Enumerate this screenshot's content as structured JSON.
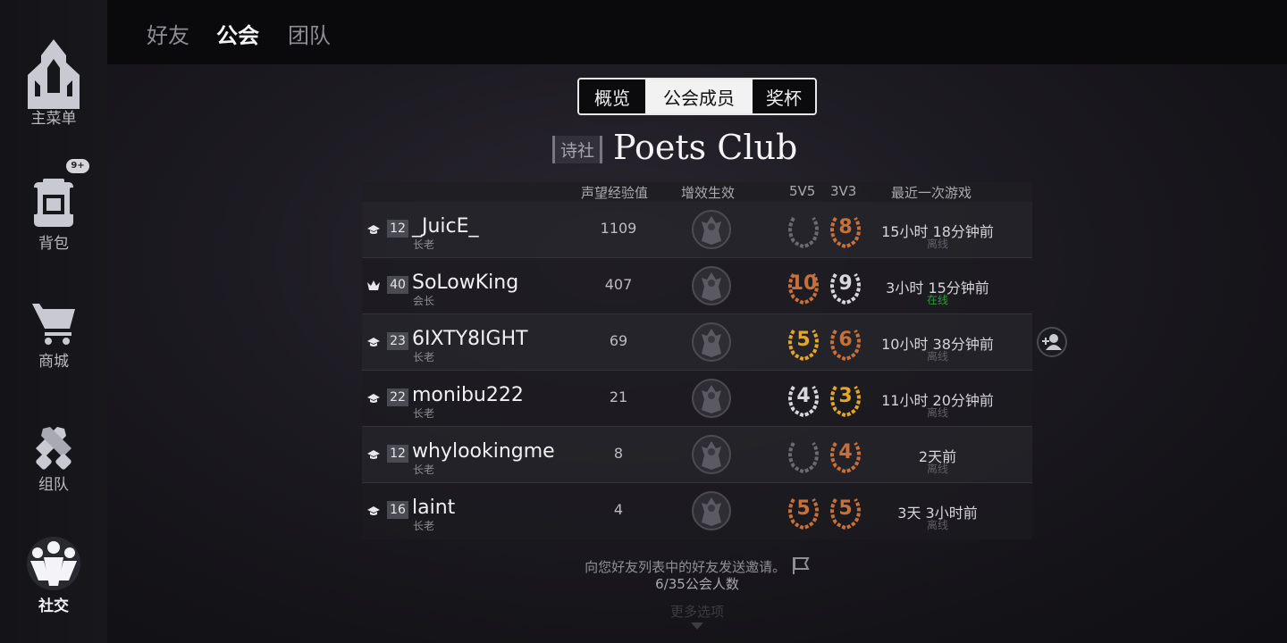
{
  "sidebar": {
    "items": [
      {
        "label": "主菜单",
        "icon": "castle-icon"
      },
      {
        "label": "背包",
        "icon": "backpack-icon",
        "badge": "9+"
      },
      {
        "label": "商城",
        "icon": "cart-icon"
      },
      {
        "label": "组队",
        "icon": "team-icon"
      },
      {
        "label": "社交",
        "icon": "social-icon",
        "active": true
      }
    ]
  },
  "top_tabs": [
    {
      "label": "好友"
    },
    {
      "label": "公会",
      "active": true
    },
    {
      "label": "团队"
    }
  ],
  "segment_tabs": [
    {
      "label": "概览"
    },
    {
      "label": "公会成员",
      "active": true
    },
    {
      "label": "奖杯"
    }
  ],
  "club": {
    "tag": "诗社",
    "name": "Poets Club"
  },
  "table": {
    "headers": {
      "reputation": "声望经验值",
      "boost": "增效生效",
      "mode_5v5": "5V5",
      "mode_3v3": "3V3",
      "last_game": "最近一次游戏"
    },
    "rows": [
      {
        "rank_icon": "elder-hat-icon",
        "level": "12",
        "name": "_JuicE_",
        "role": "长老",
        "reputation": "1109",
        "m5v5": "",
        "m5v5_color": "#6a6a70",
        "m3v3": "8",
        "m3v3_color": "#c8703a",
        "last_game": "15小时 18分钟前",
        "status": "离线"
      },
      {
        "rank_icon": "crown-icon",
        "level": "40",
        "name": "SoLowKing",
        "role": "会长",
        "reputation": "407",
        "m5v5": "10",
        "m5v5_color": "#c8703a",
        "m3v3": "9",
        "m3v3_color": "#d8d8dc",
        "last_game": "3小时 15分钟前",
        "status": "在线"
      },
      {
        "rank_icon": "elder-hat-icon",
        "level": "23",
        "name": "6IXTY8IGHT",
        "role": "长老",
        "reputation": "69",
        "m5v5": "5",
        "m5v5_color": "#e3a62a",
        "m3v3": "6",
        "m3v3_color": "#c8703a",
        "last_game": "10小时 38分钟前",
        "status": "离线"
      },
      {
        "rank_icon": "elder-hat-icon",
        "level": "22",
        "name": "monibu222",
        "role": "长老",
        "reputation": "21",
        "m5v5": "4",
        "m5v5_color": "#d8d8dc",
        "m3v3": "3",
        "m3v3_color": "#e3a62a",
        "last_game": "11小时 20分钟前",
        "status": "离线"
      },
      {
        "rank_icon": "elder-hat-icon",
        "level": "12",
        "name": "whylookingme",
        "role": "长老",
        "reputation": "8",
        "m5v5": "",
        "m5v5_color": "#6a6a70",
        "m3v3": "4",
        "m3v3_color": "#c8703a",
        "last_game": "2天前",
        "status": "离线"
      },
      {
        "rank_icon": "elder-hat-icon",
        "level": "16",
        "name": "laint",
        "role": "长老",
        "reputation": "4",
        "m5v5": "5",
        "m5v5_color": "#c8703a",
        "m3v3": "5",
        "m3v3_color": "#c8703a",
        "last_game": "3天 3小时前",
        "status": "离线"
      }
    ]
  },
  "footer": {
    "invite": "向您好友列表中的好友发送邀请。",
    "count": "6/35公会人数",
    "more": "更多选项"
  },
  "colors": {
    "online": "#2f9a3a",
    "offline": "#5f5f66"
  }
}
